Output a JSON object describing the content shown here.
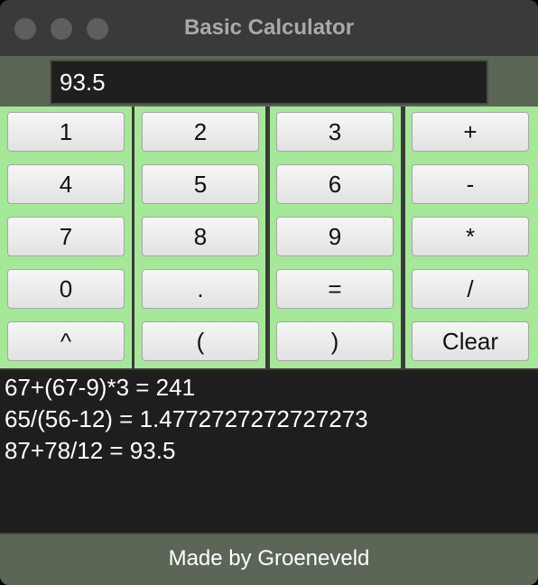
{
  "window": {
    "title": "Basic Calculator"
  },
  "display": {
    "value": "93.5"
  },
  "keypad": {
    "columns": [
      [
        "1",
        "4",
        "7",
        "0",
        "^"
      ],
      [
        "2",
        "5",
        "8",
        ".",
        "("
      ],
      [
        "3",
        "6",
        "9",
        "=",
        ")"
      ],
      [
        "+",
        "-",
        "*",
        "/",
        "Clear"
      ]
    ]
  },
  "history": [
    "67+(67-9)*3 = 241",
    "65/(56-12) = 1.4772727272727273",
    "87+78/12 = 93.5"
  ],
  "footer": {
    "text": "Made by Groeneveld"
  },
  "colors": {
    "keypad_background": "#a5e898",
    "panel": "#5c6656",
    "display_background": "#1f1f1f"
  }
}
